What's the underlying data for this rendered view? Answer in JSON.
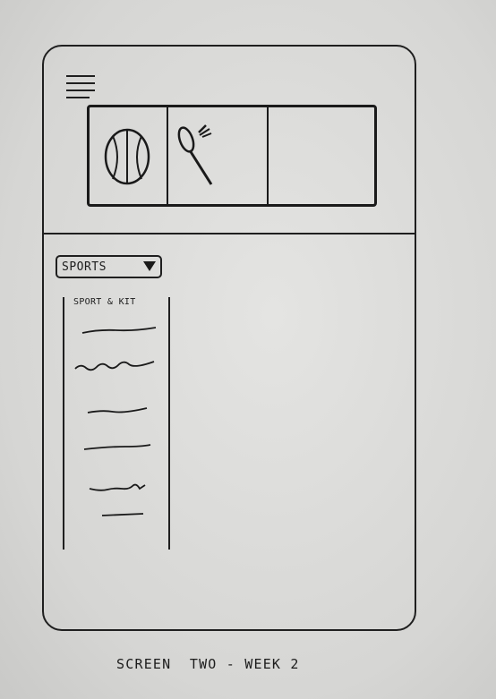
{
  "header": {
    "menu_icon": "hamburger-icon"
  },
  "carousel": {
    "tiles": [
      {
        "icon": "basketball-icon"
      },
      {
        "icon": "badminton-icon"
      },
      {
        "icon": ""
      }
    ]
  },
  "filter": {
    "selected": "SPORTS",
    "caret_icon": "caret-down-icon"
  },
  "list": {
    "title": "SPORT & KIT",
    "item_count": 6
  },
  "caption": "SCREEN  TWO - WEEK 2",
  "colors": {
    "paper": "#dcdcda",
    "ink": "#1f1f1f"
  }
}
